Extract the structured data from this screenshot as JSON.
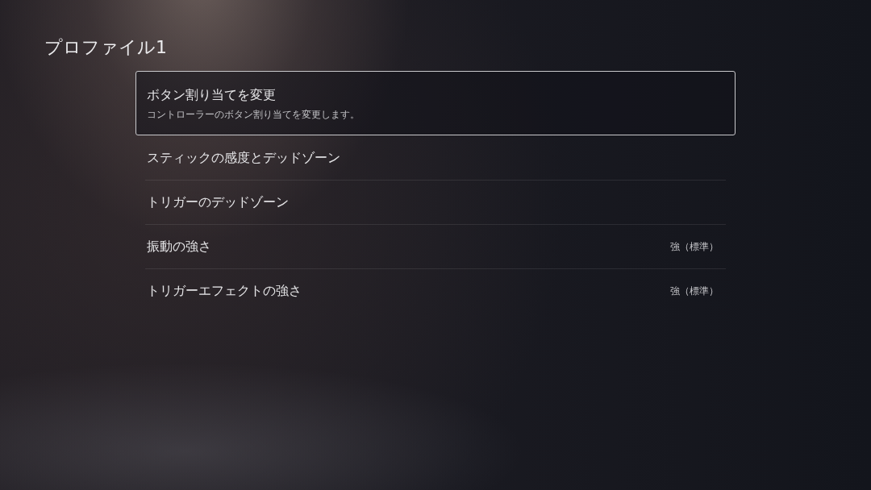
{
  "page": {
    "title": "プロファイル1"
  },
  "menu": {
    "items": [
      {
        "label": "ボタン割り当てを変更",
        "description": "コントローラーのボタン割り当てを変更します。",
        "selected": true
      },
      {
        "label": "スティックの感度とデッドゾーン",
        "selected": false
      },
      {
        "label": "トリガーのデッドゾーン",
        "selected": false
      },
      {
        "label": "振動の強さ",
        "value": "強（標準）",
        "selected": false
      },
      {
        "label": "トリガーエフェクトの強さ",
        "value": "強（標準）",
        "selected": false
      }
    ]
  }
}
